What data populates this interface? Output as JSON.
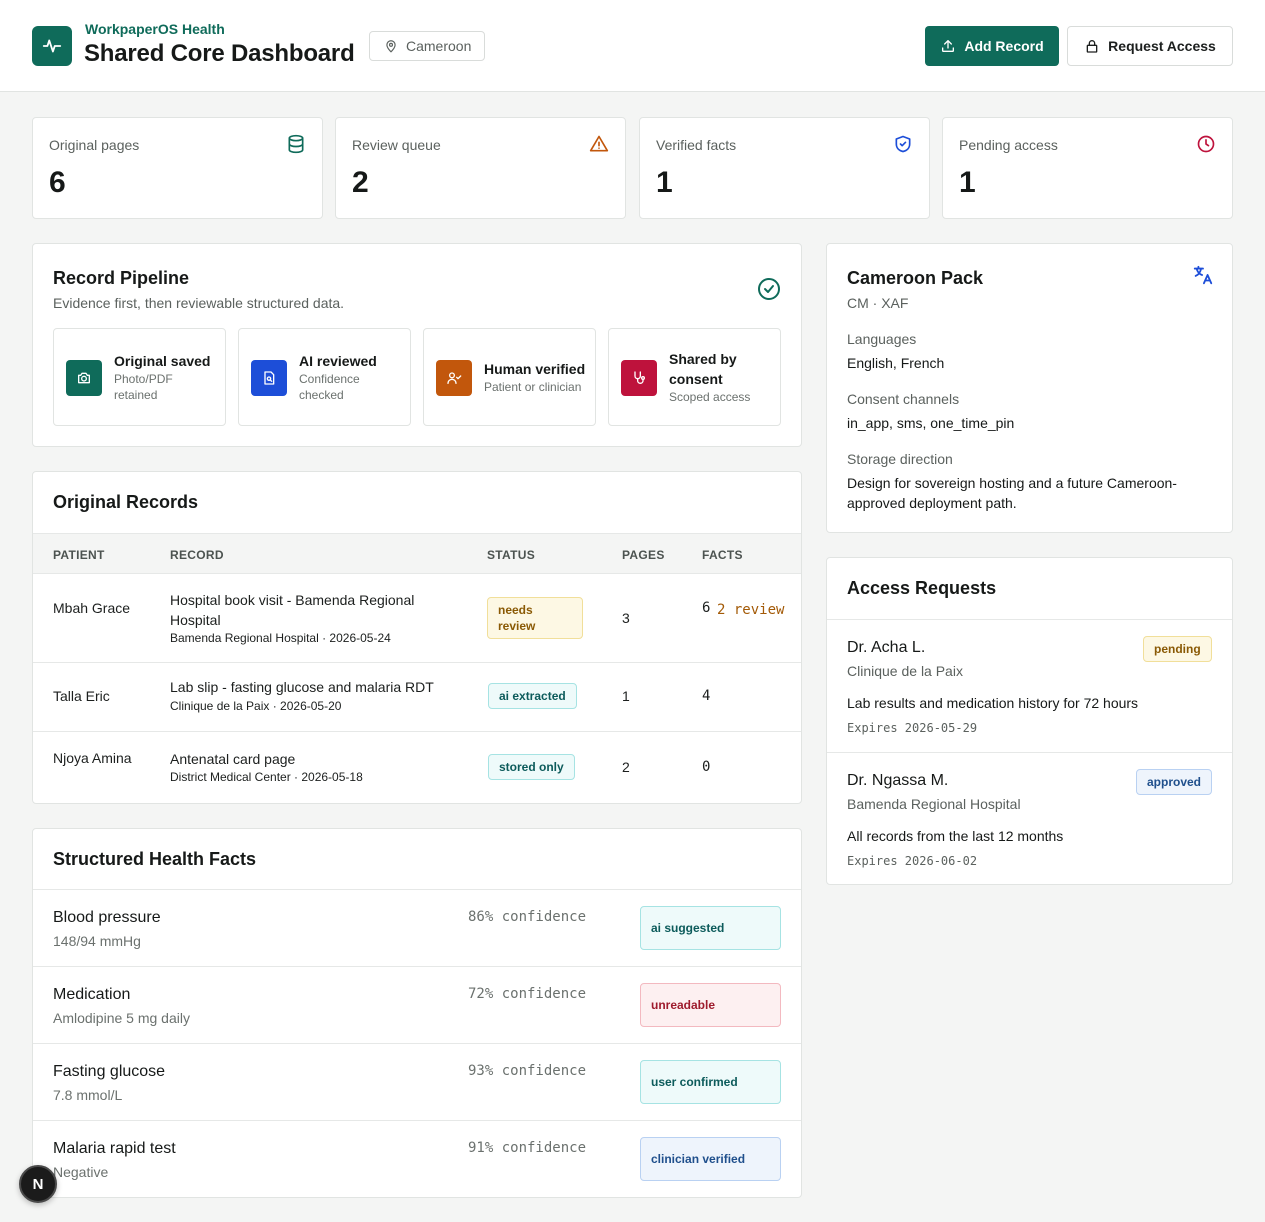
{
  "header": {
    "kicker": "WorkpaperOS Health",
    "title": "Shared Core Dashboard",
    "region": "Cameroon",
    "add_record": "Add Record",
    "request_access": "Request Access"
  },
  "stats": [
    {
      "label": "Original pages",
      "value": "6",
      "icon": "database-icon"
    },
    {
      "label": "Review queue",
      "value": "2",
      "icon": "warning-triangle-icon"
    },
    {
      "label": "Verified facts",
      "value": "1",
      "icon": "shield-check-icon"
    },
    {
      "label": "Pending access",
      "value": "1",
      "icon": "clock-icon"
    }
  ],
  "pipeline": {
    "title": "Record Pipeline",
    "subtitle": "Evidence first, then reviewable structured data.",
    "steps": [
      {
        "title": "Original saved",
        "sub": "Photo/PDF retained",
        "icon": "camera-icon",
        "color": "#0f6b5a"
      },
      {
        "title": "AI reviewed",
        "sub": "Confidence checked",
        "icon": "file-search-icon",
        "color": "#1d4ed8"
      },
      {
        "title": "Human verified",
        "sub": "Patient or clinician",
        "icon": "user-check-icon",
        "color": "#c2570c"
      },
      {
        "title": "Shared by consent",
        "sub": "Scoped access",
        "icon": "stethoscope-icon",
        "color": "#be123c"
      }
    ]
  },
  "records": {
    "title": "Original Records",
    "columns": [
      "PATIENT",
      "RECORD",
      "STATUS",
      "PAGES",
      "FACTS"
    ],
    "rows": [
      {
        "patient": "Mbah Grace",
        "record": "Hospital book visit - Bamenda Regional Hospital",
        "meta": "Bamenda Regional Hospital · 2026-05-24",
        "status": "needs review",
        "pages": "3",
        "facts": "6",
        "review": "2 review"
      },
      {
        "patient": "Talla Eric",
        "record": "Lab slip - fasting glucose and malaria RDT",
        "meta": "Clinique de la Paix · 2026-05-20",
        "status": "ai extracted",
        "pages": "1",
        "facts": "4",
        "review": ""
      },
      {
        "patient": "Njoya Amina",
        "record": "Antenatal card page",
        "meta": "District Medical Center · 2026-05-18",
        "status": "stored only",
        "pages": "2",
        "facts": "0",
        "review": ""
      }
    ]
  },
  "facts": {
    "title": "Structured Health Facts",
    "items": [
      {
        "name": "Blood pressure",
        "value": "148/94 mmHg",
        "confidence": "86% confidence",
        "status": "ai suggested"
      },
      {
        "name": "Medication",
        "value": "Amlodipine 5 mg daily",
        "confidence": "72% confidence",
        "status": "unreadable"
      },
      {
        "name": "Fasting glucose",
        "value": "7.8 mmol/L",
        "confidence": "93% confidence",
        "status": "user confirmed"
      },
      {
        "name": "Malaria rapid test",
        "value": "Negative",
        "confidence": "91% confidence",
        "status": "clinician verified"
      }
    ]
  },
  "country_pack": {
    "title": "Cameroon Pack",
    "code": "CM · XAF",
    "languages_label": "Languages",
    "languages": "English, French",
    "channels_label": "Consent channels",
    "channels": "in_app, sms, one_time_pin",
    "storage_label": "Storage direction",
    "storage": "Design for sovereign hosting and a future Cameroon-approved deployment path."
  },
  "access": {
    "title": "Access Requests",
    "requests": [
      {
        "name": "Dr. Acha L.",
        "org": "Clinique de la Paix",
        "scope": "Lab results and medication history for 72 hours",
        "expires": "Expires 2026-05-29",
        "status": "pending"
      },
      {
        "name": "Dr. Ngassa M.",
        "org": "Bamenda Regional Hospital",
        "scope": "All records from the last 12 months",
        "expires": "Expires 2026-06-02",
        "status": "approved"
      }
    ]
  },
  "dev_badge": "N"
}
